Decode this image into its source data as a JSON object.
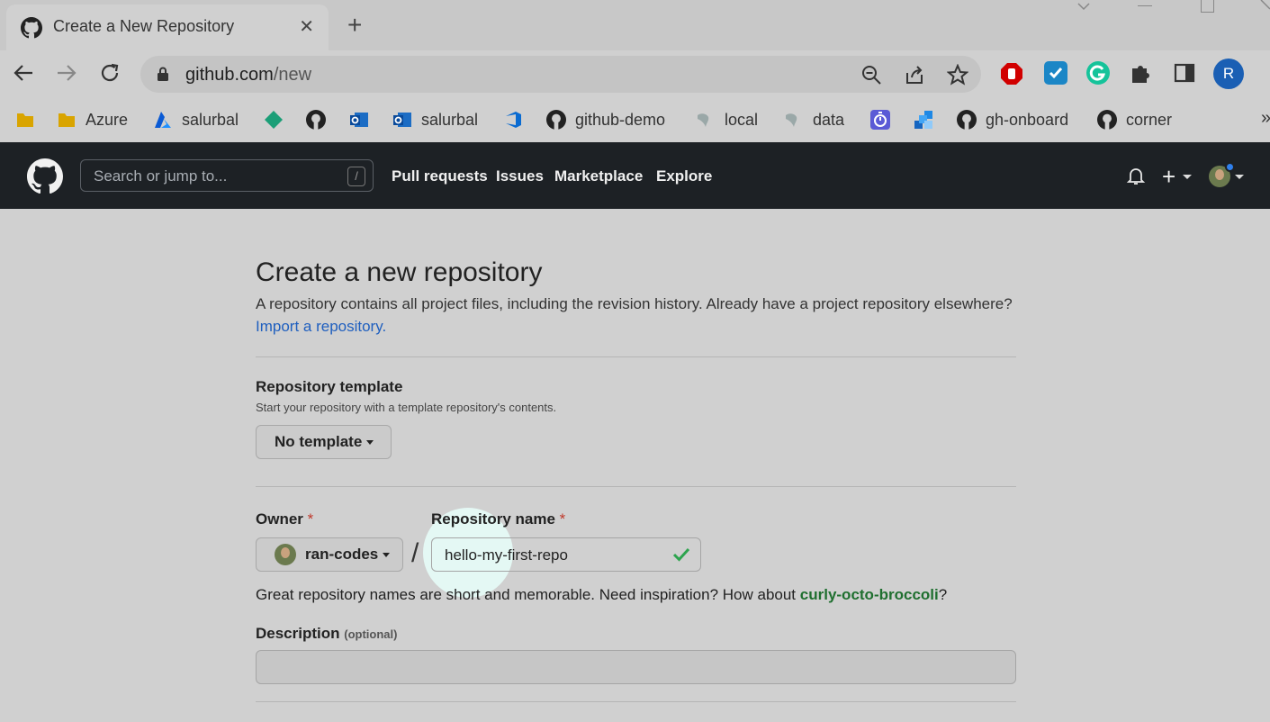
{
  "browser": {
    "tab": {
      "title": "Create a New Repository",
      "close": "✕",
      "favicon": "github-icon"
    },
    "newtab": "+",
    "window_controls": [
      "chevron-down-icon",
      "minimize-icon",
      "maximize-icon",
      "close-icon"
    ],
    "url": {
      "host": "github.com",
      "path": "/new"
    },
    "omnibox_icons": [
      "zoom-icon",
      "share-icon",
      "star-icon"
    ],
    "extensions": [
      "adblock-icon",
      "checklist-icon",
      "grammarly-icon",
      "puzzle-icon",
      "sidepanel-icon"
    ],
    "profile_initial": "R",
    "bookmarks": [
      {
        "label": "",
        "icon": "folder-icon"
      },
      {
        "label": "Azure",
        "icon": "folder-icon"
      },
      {
        "label": "salurbal",
        "icon": "azure-icon"
      },
      {
        "label": "",
        "icon": "diamond-icon"
      },
      {
        "label": "",
        "icon": "github-icon"
      },
      {
        "label": "",
        "icon": "outlook-icon"
      },
      {
        "label": "salurbal",
        "icon": "outlook-icon"
      },
      {
        "label": "",
        "icon": "devops-icon"
      },
      {
        "label": "github-demo",
        "icon": "github-icon"
      },
      {
        "label": "local",
        "icon": "map-icon"
      },
      {
        "label": "data",
        "icon": "map-icon"
      },
      {
        "label": "",
        "icon": "timer-icon"
      },
      {
        "label": "",
        "icon": "blocks-icon"
      },
      {
        "label": "gh-onboard",
        "icon": "github-icon"
      },
      {
        "label": "corner",
        "icon": "github-icon"
      }
    ],
    "bookmarks_overflow": "»"
  },
  "github": {
    "search_placeholder": "Search or jump to...",
    "search_key": "/",
    "nav": [
      "Pull requests",
      "Issues",
      "Marketplace",
      "Explore"
    ],
    "plus": "+"
  },
  "page": {
    "title": "Create a new repository",
    "lead": "A repository contains all project files, including the revision history. Already have a project repository elsewhere?",
    "import_link": "Import a repository.",
    "template_label": "Repository template",
    "template_help": "Start your repository with a template repository's contents.",
    "template_button": "No template",
    "owner_label": "Owner",
    "required_mark": "*",
    "owner_value": "ran-codes",
    "separator": "/",
    "repo_label": "Repository name",
    "repo_value": "hello-my-first-repo",
    "hint_prefix": "Great repository names are short and memorable. Need inspiration? How about",
    "hint_suggestion": "curly-octo-broccoli",
    "hint_suffix": "?",
    "description_label": "Description",
    "description_optional": "(optional)",
    "description_value": ""
  },
  "colors": {
    "github_header": "#1d2125",
    "link": "#1f5fbf",
    "suggestion": "#1f6f2f",
    "success": "#2da44e"
  }
}
